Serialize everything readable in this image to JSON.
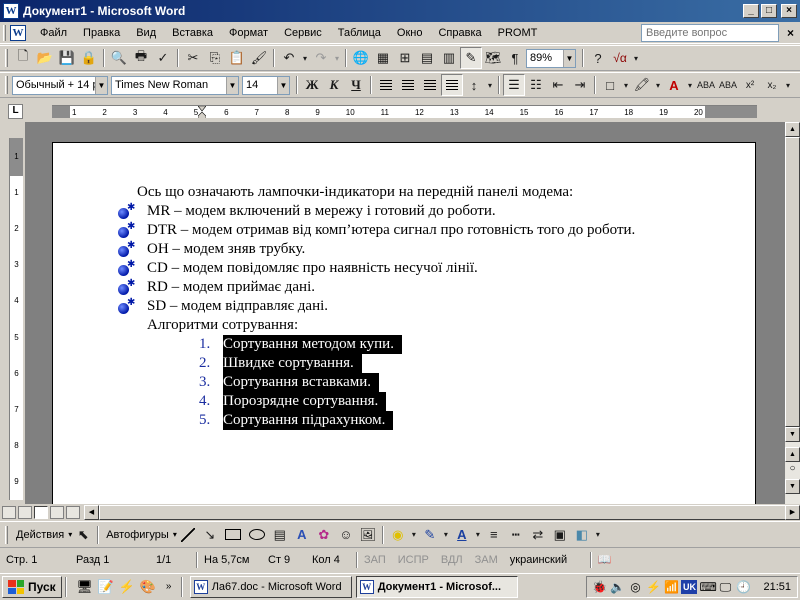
{
  "window": {
    "title": "Документ1 - Microsoft Word",
    "app_icon": "W"
  },
  "menu": {
    "items": [
      "Файл",
      "Правка",
      "Вид",
      "Вставка",
      "Формат",
      "Сервис",
      "Таблица",
      "Окно",
      "Справка",
      "PROMT"
    ],
    "help_placeholder": "Введите вопрос"
  },
  "standard_toolbar": {
    "zoom": "89%"
  },
  "formatting_toolbar": {
    "style": "Обычный + 14 р",
    "font": "Times New Roman",
    "size": "14",
    "bold": "Ж",
    "italic": "К",
    "underline": "Ч"
  },
  "ruler": {
    "ticks": [
      "1",
      "2",
      "3",
      "4",
      "5",
      "6",
      "7",
      "8",
      "9",
      "10",
      "11",
      "12",
      "13",
      "14",
      "15",
      "16",
      "17",
      "18",
      "19",
      "20"
    ],
    "vticks": [
      "1",
      "1",
      "2",
      "3",
      "4",
      "5",
      "6",
      "7",
      "8",
      "9"
    ]
  },
  "document": {
    "intro": "Ось що означають лампочки-індикатори на передній панелі модема:",
    "bullets": [
      "MR – модем включений в мережу і готовий до роботи.",
      "DTR – модем отримав від комп’ютера сигнал про готовність того до роботи.",
      "OH – модем зняв трубку.",
      "CD – модем повідомляє про наявність несучої лінії.",
      "RD – модем приймає дані.",
      "SD – модем відправляє дані."
    ],
    "algo_label": "Алгоритми сотрування:",
    "numbered": [
      {
        "num": "1.",
        "text": "Сортування методом купи."
      },
      {
        "num": "2.",
        "text": "Швидке сортування."
      },
      {
        "num": "3.",
        "text": "Сортування вставками."
      },
      {
        "num": "4.",
        "text": "Порозрядне сортування."
      },
      {
        "num": "5.",
        "text": "Сортування підрахунком."
      }
    ]
  },
  "drawing_toolbar": {
    "actions": "Действия",
    "autoshapes": "Автофигуры"
  },
  "status": {
    "page": "Стр. 1",
    "section": "Разд 1",
    "pages": "1/1",
    "at": "На 5,7см",
    "line": "Ст 9",
    "col": "Кол 4",
    "rec": "ЗАП",
    "trk": "ИСПР",
    "ext": "ВДЛ",
    "ovr": "ЗАМ",
    "language": "украинский"
  },
  "taskbar": {
    "start": "Пуск",
    "tasks": [
      "Ла67.doc - Microsoft Word",
      "Документ1 - Microsof..."
    ],
    "lang": "UK",
    "clock": "21:51"
  }
}
